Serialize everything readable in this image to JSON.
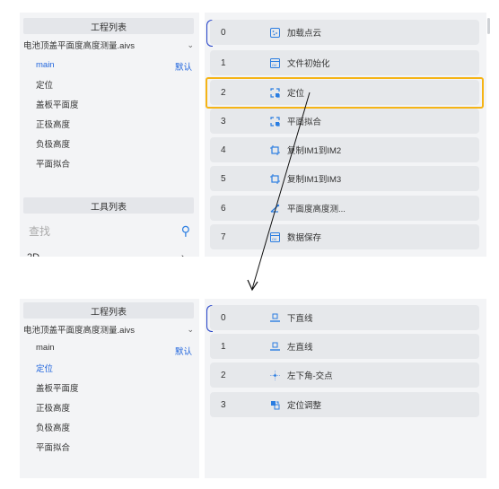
{
  "top": {
    "project_header": "工程列表",
    "project_file": "电池顶盖平面度高度测量.aivs",
    "tree": [
      {
        "label": "main",
        "active": true
      },
      {
        "label": "定位",
        "active": false
      },
      {
        "label": "盖板平面度",
        "active": false
      },
      {
        "label": "正极高度",
        "active": false
      },
      {
        "label": "负极高度",
        "active": false
      },
      {
        "label": "平面拟合",
        "active": false
      }
    ],
    "default_tag": "默认",
    "tool_header": "工具列表",
    "search_placeholder": "查找",
    "cut_category": "2D",
    "steps": [
      {
        "index": "0",
        "icon": "point-cloud-icon",
        "label": "加载点云"
      },
      {
        "index": "1",
        "icon": "file-init-icon",
        "label": "文件初始化"
      },
      {
        "index": "2",
        "icon": "locate-icon",
        "label": "定位"
      },
      {
        "index": "3",
        "icon": "locate-icon",
        "label": "平面拟合"
      },
      {
        "index": "4",
        "icon": "copy-image-icon",
        "label": "复制IM1到IM2"
      },
      {
        "index": "5",
        "icon": "copy-image-icon",
        "label": "复制IM1到IM3"
      },
      {
        "index": "6",
        "icon": "measure-icon",
        "label": "平面度高度测..."
      },
      {
        "index": "7",
        "icon": "save-data-icon",
        "label": "数据保存"
      }
    ]
  },
  "bottom": {
    "project_header": "工程列表",
    "project_file": "电池顶盖平面度高度测量.aivs",
    "tree": [
      {
        "label": "main",
        "active": false
      },
      {
        "label": "定位",
        "active": true
      },
      {
        "label": "盖板平面度",
        "active": false
      },
      {
        "label": "正极高度",
        "active": false
      },
      {
        "label": "负极高度",
        "active": false
      },
      {
        "label": "平面拟合",
        "active": false
      }
    ],
    "default_tag": "默认",
    "steps": [
      {
        "index": "0",
        "icon": "line-icon",
        "label": "下直线"
      },
      {
        "index": "1",
        "icon": "line-icon",
        "label": "左直线"
      },
      {
        "index": "2",
        "icon": "intersection-icon",
        "label": "左下角-交点"
      },
      {
        "index": "3",
        "icon": "adjust-icon",
        "label": "定位调整"
      }
    ]
  },
  "colors": {
    "accent": "#2266dd",
    "highlight": "#f5b416",
    "panel": "#f3f4f6",
    "step_bg": "#e6e8eb"
  }
}
